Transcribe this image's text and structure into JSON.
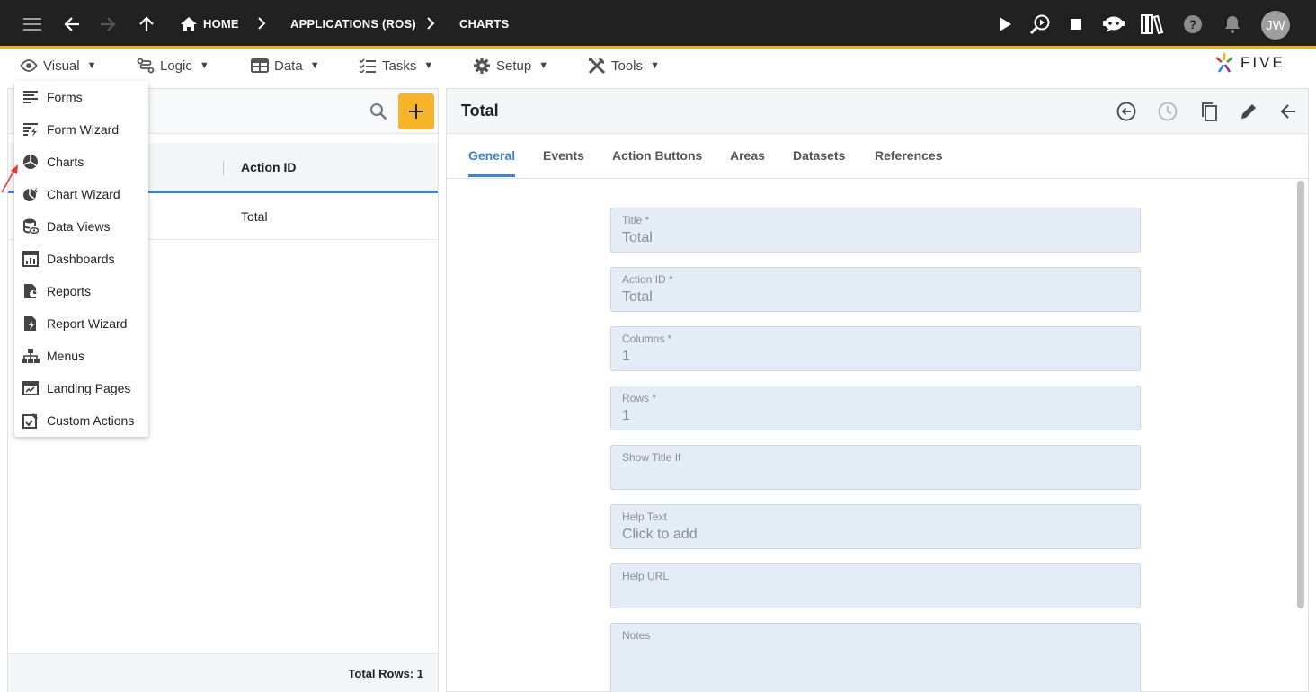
{
  "topbar": {
    "breadcrumbs": [
      {
        "label": "HOME"
      },
      {
        "label": "APPLICATIONS (ROS)"
      },
      {
        "label": "CHARTS"
      }
    ],
    "avatar_initials": "JW",
    "icons": [
      "menu-icon",
      "back-arrow-icon",
      "forward-arrow-icon",
      "up-arrow-icon",
      "home-icon",
      "play-icon",
      "debug-search-icon",
      "stop-icon",
      "chat-bot-icon",
      "library-icon",
      "help-icon",
      "bell-icon"
    ]
  },
  "menubar": {
    "items": [
      {
        "label": "Visual",
        "icon": "eye-icon"
      },
      {
        "label": "Logic",
        "icon": "logic-icon"
      },
      {
        "label": "Data",
        "icon": "table-icon"
      },
      {
        "label": "Tasks",
        "icon": "tasks-icon"
      },
      {
        "label": "Setup",
        "icon": "gear-icon"
      },
      {
        "label": "Tools",
        "icon": "tools-icon"
      }
    ],
    "caret": "▼",
    "logo_text": "FIVE"
  },
  "dropdown": {
    "items": [
      {
        "label": "Forms",
        "icon": "forms-icon"
      },
      {
        "label": "Form Wizard",
        "icon": "form-wizard-icon"
      },
      {
        "label": "Charts",
        "icon": "charts-icon"
      },
      {
        "label": "Chart Wizard",
        "icon": "chart-wizard-icon"
      },
      {
        "label": "Data Views",
        "icon": "data-views-icon"
      },
      {
        "label": "Dashboards",
        "icon": "dashboards-icon"
      },
      {
        "label": "Reports",
        "icon": "reports-icon"
      },
      {
        "label": "Report Wizard",
        "icon": "report-wizard-icon"
      },
      {
        "label": "Menus",
        "icon": "menus-icon"
      },
      {
        "label": "Landing Pages",
        "icon": "landing-pages-icon"
      },
      {
        "label": "Custom Actions",
        "icon": "custom-actions-icon"
      }
    ]
  },
  "left_panel": {
    "column_header": "Action ID",
    "rows": [
      {
        "action_id": "Total"
      }
    ],
    "footer": "Total Rows: 1"
  },
  "right_panel": {
    "title": "Total",
    "tabs": [
      {
        "label": "General",
        "active": true
      },
      {
        "label": "Events",
        "active": false
      },
      {
        "label": "Action Buttons",
        "active": false
      },
      {
        "label": "Areas",
        "active": false
      },
      {
        "label": "Datasets",
        "active": false
      },
      {
        "label": "References",
        "active": false
      }
    ],
    "fields": [
      {
        "label": "Title *",
        "value": "Total"
      },
      {
        "label": "Action ID *",
        "value": "Total"
      },
      {
        "label": "Columns *",
        "value": "1"
      },
      {
        "label": "Rows *",
        "value": "1"
      },
      {
        "label": "Show Title If",
        "value": ""
      },
      {
        "label": "Help Text",
        "value": "Click to add"
      },
      {
        "label": "Help URL",
        "value": ""
      },
      {
        "label": "Notes",
        "value": ""
      }
    ]
  },
  "colors": {
    "topbar": "#212121",
    "accent_yellow": "#f5b400",
    "add_button": "#f5b42a",
    "active_tab": "#3b83d6",
    "field_bg": "#e4ecf5"
  }
}
